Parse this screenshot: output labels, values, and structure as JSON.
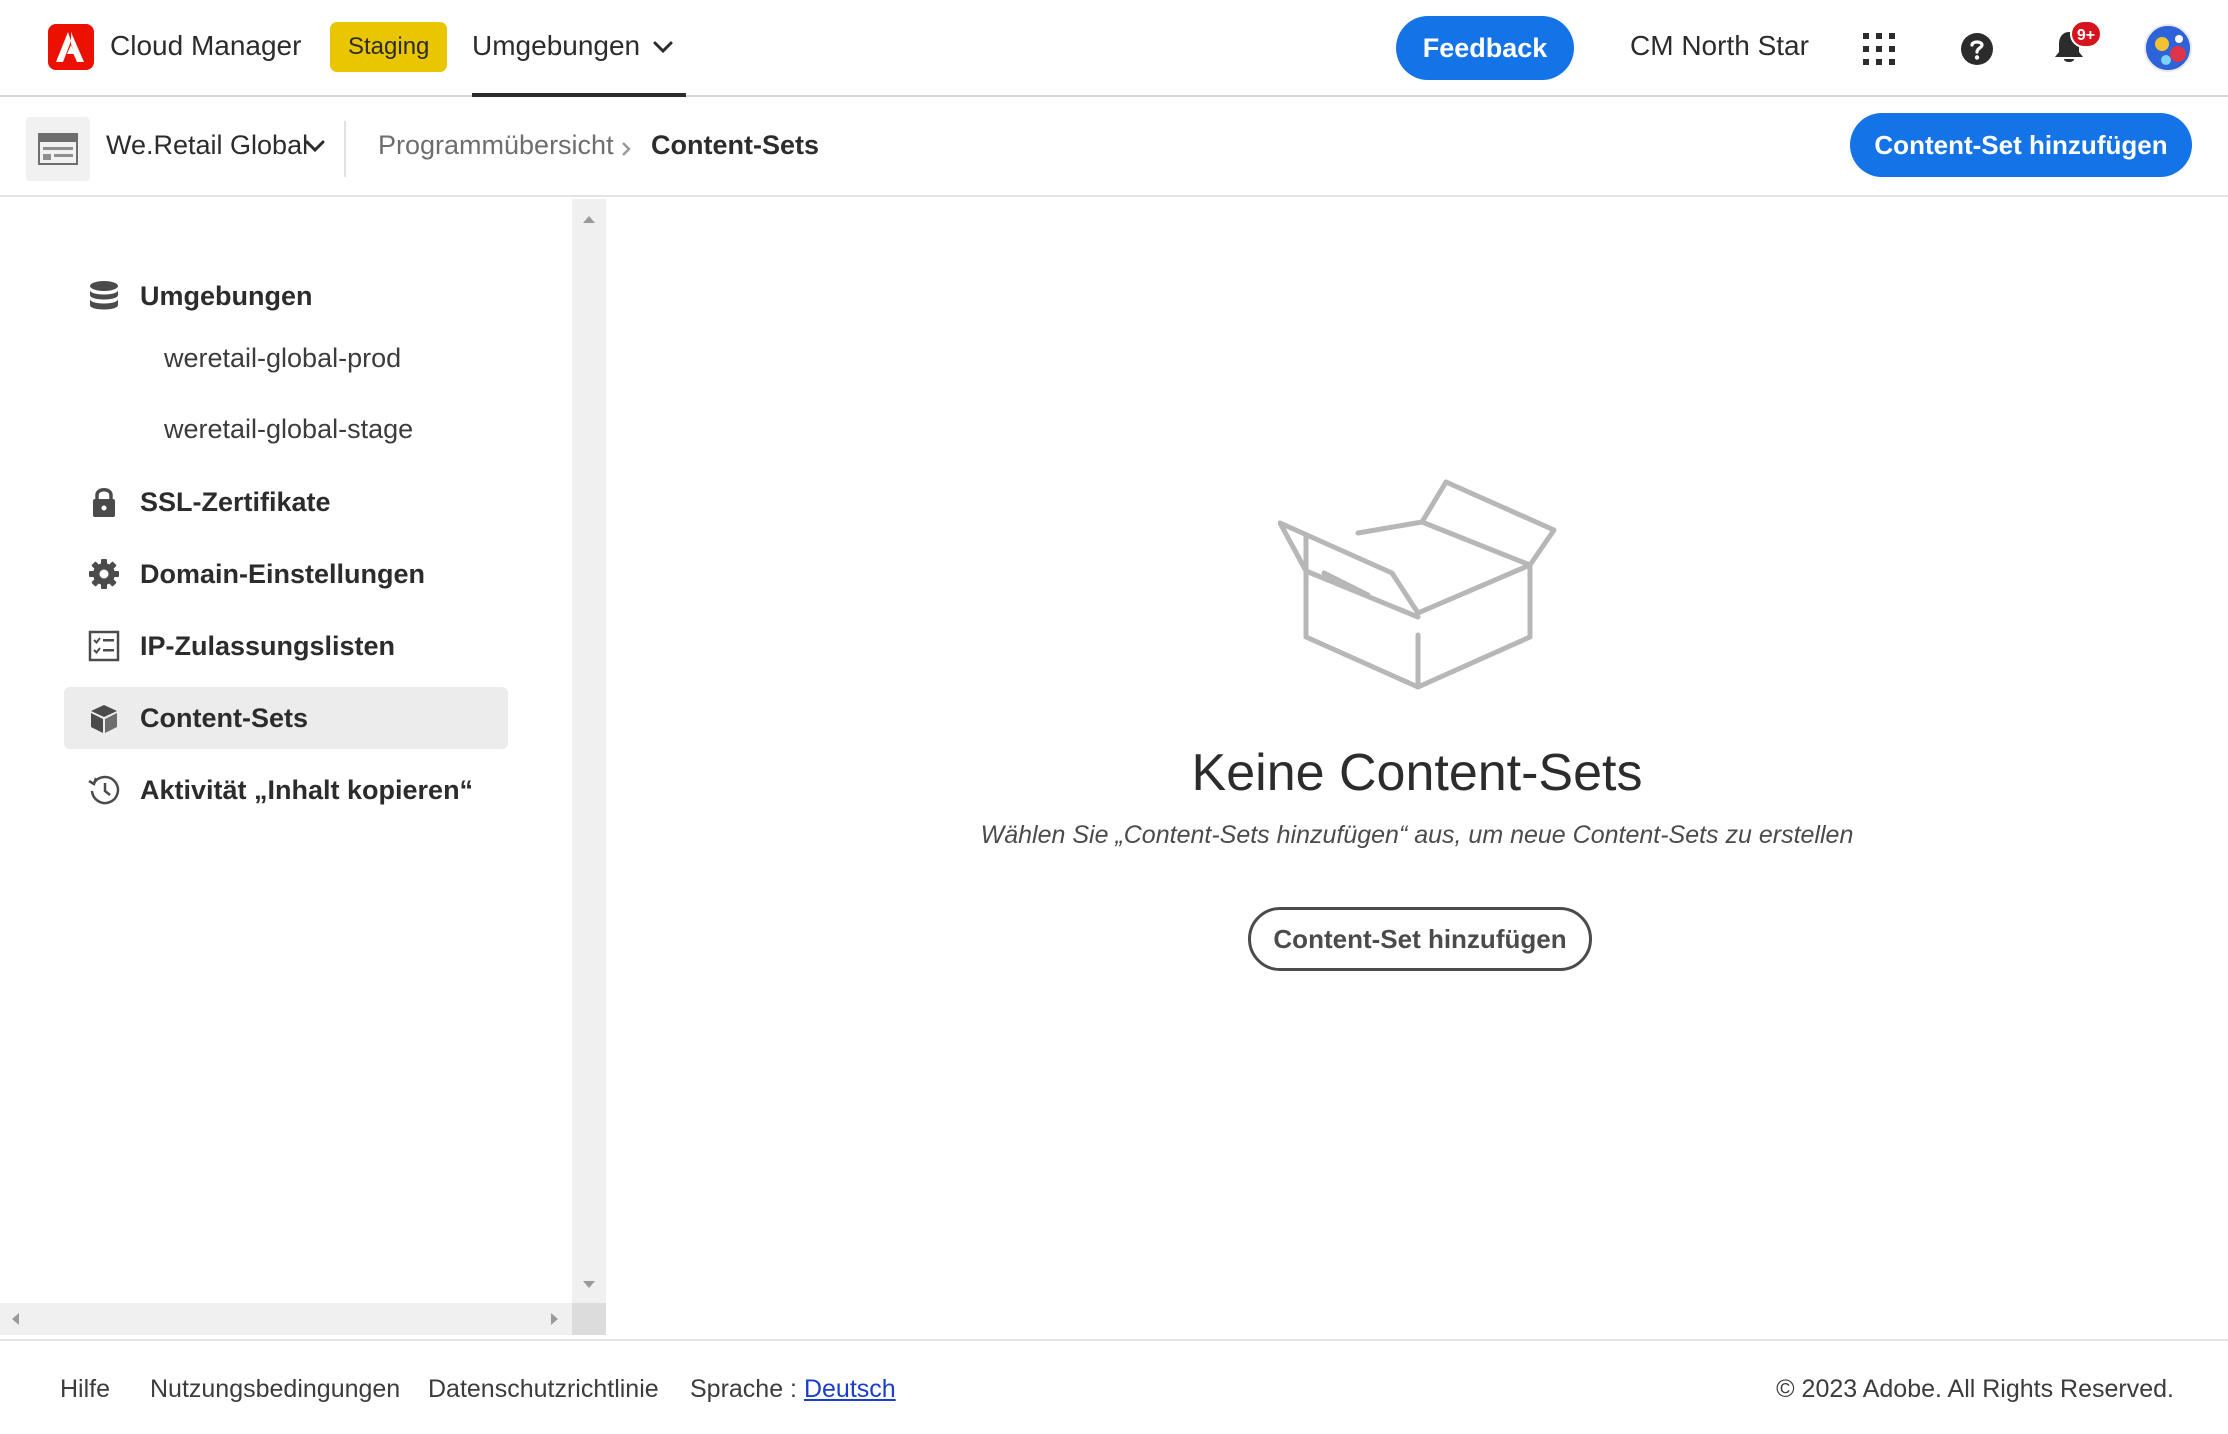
{
  "header": {
    "app_title": "Cloud Manager",
    "env_badge": "Staging",
    "env_menu_label": "Umgebungen",
    "feedback_label": "Feedback",
    "org_name": "CM North Star",
    "notification_count": "9+",
    "colors": {
      "brand": "#eb1000",
      "badge": "#e9c600",
      "accent": "#1473e6"
    }
  },
  "subheader": {
    "program_name": "We.Retail Global",
    "breadcrumb": [
      "Programmübersicht",
      "Content-Sets"
    ],
    "primary_action": "Content-Set hinzufügen"
  },
  "sidebar": {
    "items": [
      {
        "label": "Umgebungen",
        "icon": "database-icon"
      },
      {
        "label": "weretail-global-prod"
      },
      {
        "label": "weretail-global-stage"
      },
      {
        "label": "SSL-Zertifikate",
        "icon": "lock-icon"
      },
      {
        "label": "Domain-Einstellungen",
        "icon": "gear-icon"
      },
      {
        "label": "IP-Zulassungslisten",
        "icon": "checklist-icon"
      },
      {
        "label": "Content-Sets",
        "icon": "box-icon",
        "active": true
      },
      {
        "label": "Aktivität „Inhalt kopieren“",
        "icon": "history-icon"
      }
    ]
  },
  "empty_state": {
    "icon": "open-box-icon",
    "title": "Keine Content-Sets",
    "description": "Wählen Sie „Content-Sets hinzufügen“ aus, um neue Content-Sets zu erstellen",
    "button_label": "Content-Set hinzufügen"
  },
  "footer": {
    "links": [
      "Hilfe",
      "Nutzungsbedingungen",
      "Datenschutzrichtlinie"
    ],
    "language_label": "Sprache : ",
    "language_value": "Deutsch",
    "copyright": "© 2023 Adobe. All Rights Reserved."
  }
}
